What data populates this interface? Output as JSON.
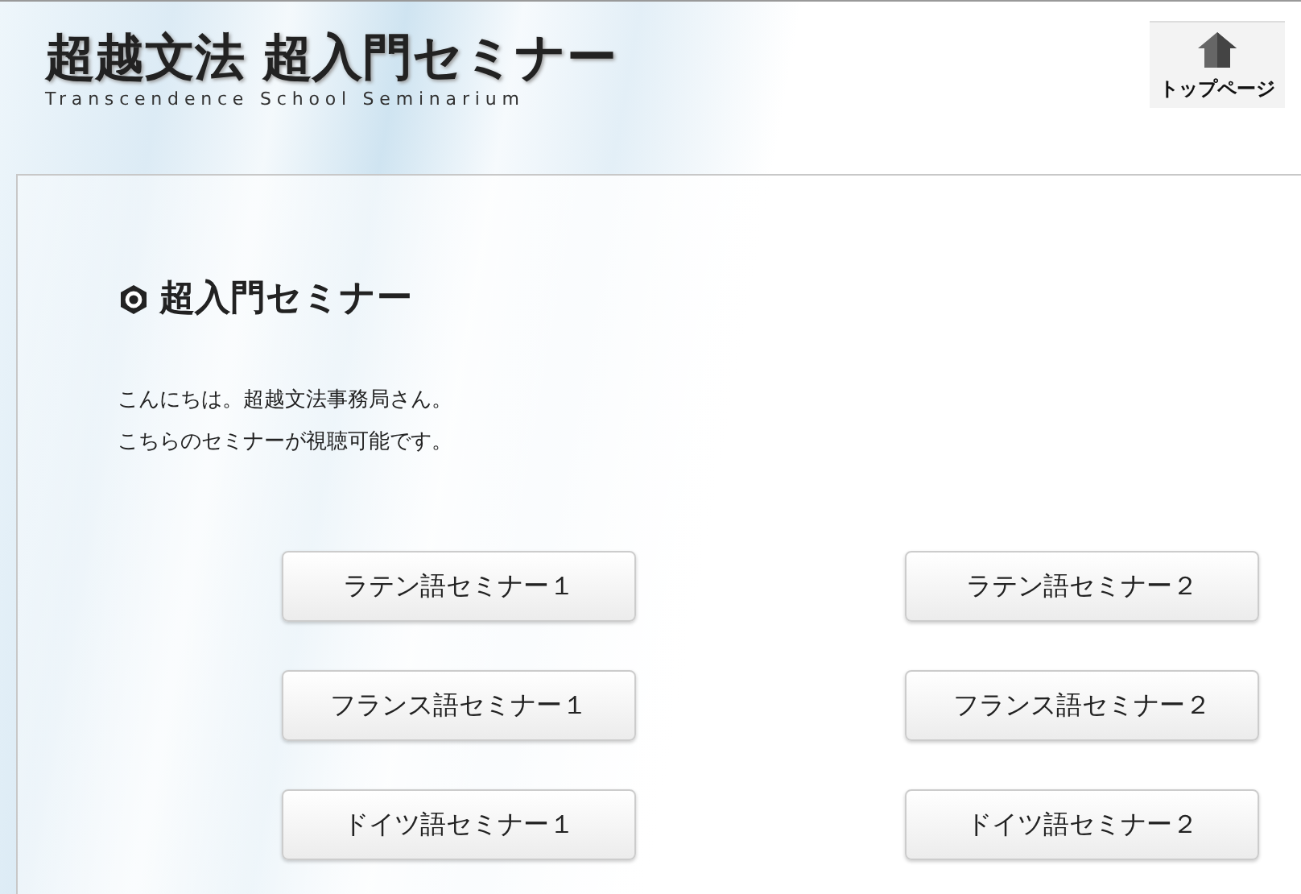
{
  "header": {
    "site_title": "超越文法 超入門セミナー",
    "site_subtitle": "Transcendence School Seminarium",
    "top_link": "トップページ"
  },
  "main": {
    "heading": "超入門セミナー",
    "greeting": [
      "こんにちは。超越文法事務局さん。",
      "こちらのセミナーが視聴可能です。"
    ],
    "seminars": [
      {
        "label": "ラテン語セミナー１"
      },
      {
        "label": "ラテン語セミナー２"
      },
      {
        "label": "フランス語セミナー１"
      },
      {
        "label": "フランス語セミナー２"
      },
      {
        "label": "ドイツ語セミナー１"
      },
      {
        "label": "ドイツ語セミナー２"
      }
    ]
  }
}
